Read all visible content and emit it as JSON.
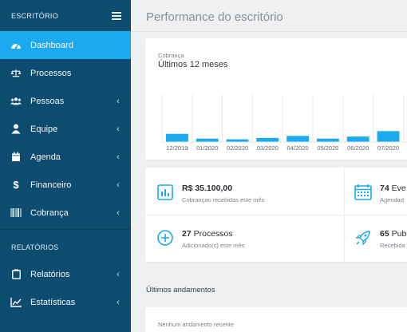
{
  "sidebar": {
    "title": "ESCRITÓRIO",
    "items": [
      {
        "label": "Dashboard",
        "icon": "dashboard-icon",
        "active": true,
        "chevron": false
      },
      {
        "label": "Processos",
        "icon": "scales-icon",
        "active": false,
        "chevron": false
      },
      {
        "label": "Pessoas",
        "icon": "people-icon",
        "active": false,
        "chevron": true
      },
      {
        "label": "Equipe",
        "icon": "user-icon",
        "active": false,
        "chevron": true
      },
      {
        "label": "Agenda",
        "icon": "calendar-icon",
        "active": false,
        "chevron": true
      },
      {
        "label": "Financeiro",
        "icon": "dollar-icon",
        "active": false,
        "chevron": true
      },
      {
        "label": "Cobrança",
        "icon": "barcode-icon",
        "active": false,
        "chevron": true
      }
    ],
    "section_label": "RELATÓRIOS",
    "report_items": [
      {
        "label": "Relatórios",
        "icon": "clipboard-icon",
        "chevron": true
      },
      {
        "label": "Estatísticas",
        "icon": "line-chart-icon",
        "chevron": true
      }
    ],
    "chevron_glyph": "‹"
  },
  "main": {
    "title": "Performance do escritório",
    "chart_card": {
      "subtitle": "Cobrança",
      "title": "Últimos 12 meses"
    },
    "stats": [
      {
        "value": "R$ 35.100,00",
        "value_light": "",
        "desc": "Cobranças recebidas este mês",
        "icon": "bar-chart-icon"
      },
      {
        "value": "74",
        "value_light": " Eve",
        "desc": "Agendad",
        "icon": "calendar-grid-icon"
      },
      {
        "value": "27",
        "value_light": " Processos",
        "desc": "Adicionado(s) este mês",
        "icon": "plus-circle-icon"
      },
      {
        "value": "65",
        "value_light": " Publ",
        "desc": "Recebida",
        "icon": "rocket-icon"
      }
    ],
    "section_title": "Últimos andamentos",
    "empty_text": "Nenhum andamento recente"
  },
  "colors": {
    "sidebar_bg": "#0d4c6f",
    "accent": "#1ba9f0",
    "bar": "#1ba9f0"
  },
  "chart_data": {
    "type": "bar",
    "title": "Últimos 12 meses",
    "subtitle": "Cobrança",
    "categories": [
      "12/2019",
      "01/2020",
      "02/2020",
      "03/2020",
      "04/2020",
      "05/2020",
      "06/2020",
      "07/2020"
    ],
    "values": [
      12,
      5,
      4,
      6,
      9,
      5,
      8,
      16
    ],
    "ylim": [
      0,
      70
    ],
    "grid": "vertical",
    "bar_color": "#1ba9f0"
  }
}
